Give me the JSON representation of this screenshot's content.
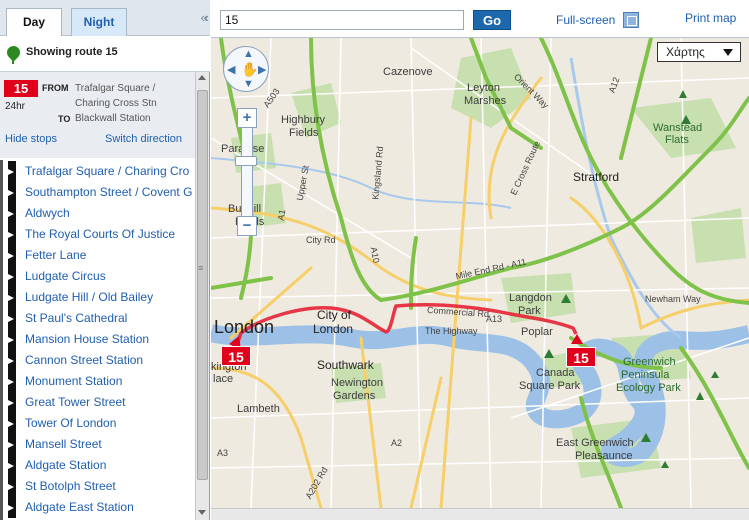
{
  "tabs": {
    "day": "Day",
    "night": "Night"
  },
  "panel": {
    "showing": "Showing route 15",
    "route_number": "15",
    "route_hours": "24hr",
    "from_label": "FROM",
    "from_value": "Trafalgar Square / Charing Cross Stn",
    "to_label": "TO",
    "to_value": "Blackwall Station",
    "hide_stops": "Hide stops",
    "switch_direction": "Switch direction"
  },
  "stops": [
    "Trafalgar Square / Charing Cro",
    "Southampton Street / Covent G",
    "Aldwych",
    "The Royal Courts Of Justice",
    "Fetter Lane",
    "Ludgate Circus",
    "Ludgate Hill / Old Bailey",
    "St Paul's Cathedral",
    "Mansion House Station",
    "Cannon Street Station",
    "Monument Station",
    "Great Tower Street",
    "Tower Of London",
    "Mansell Street",
    "Aldgate Station",
    "St Botolph Street",
    "Aldgate East Station"
  ],
  "toolbar": {
    "search_value": "15",
    "go": "Go",
    "full_screen": "Full-screen",
    "print_map": "Print map"
  },
  "map": {
    "type_selector": "Χάρτης",
    "marker_start": "15",
    "marker_end": "15",
    "labels": {
      "london": "London",
      "city": "City of",
      "city2": "London",
      "southwark": "Southwark",
      "newington": "Newington",
      "gardens": "Gardens",
      "lambeth": "Lambeth",
      "kington": "kington",
      "lace": "lace",
      "cazenove": "Cazenove",
      "leyton": "Leyton",
      "marshes": "Marshes",
      "highbury": "Highbury",
      "fields": "Fields",
      "paradise": "Paradise",
      "park": "Park",
      "bunhill": "Bunhill",
      "fields2": "Fields",
      "stratford": "Stratford",
      "wanstead": "Wanstead",
      "flats": "Flats",
      "langdon": "Langdon",
      "park2": "Park",
      "poplar": "Poplar",
      "canada": "Canada",
      "square_park": "Square Park",
      "greenwich": "Greenwich",
      "peninsula": "Peninsula",
      "ecology": "Ecology Park",
      "east_greenwich": "East Greenwich",
      "pleasaunce": "Pleasaunce",
      "newham_way": "Newham Way",
      "mile_end": "Mile End Rd - A11",
      "the_highway": "The Highway",
      "city_rd": "City Rd",
      "commercial": "Commercial Rd",
      "a13": "A13",
      "a12": "A12",
      "a10": "A10",
      "a2": "A2",
      "a3": "A3",
      "a202": "A202 Rd",
      "a503": "A503",
      "orient": "Orient Way",
      "kingsland": "Kingsland Rd",
      "upper_st": "Upper St",
      "cross_route": "E Cross Route",
      "a1": "A1"
    }
  }
}
